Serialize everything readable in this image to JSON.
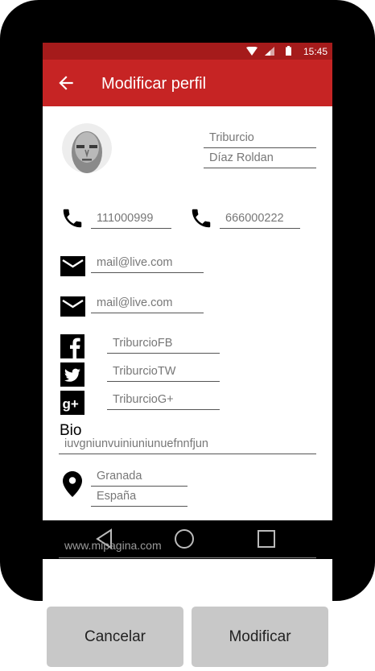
{
  "status_bar": {
    "time": "15:45"
  },
  "app_bar": {
    "title": "Modificar perfil"
  },
  "profile": {
    "first_name": "Triburcio",
    "last_name": "Díaz Roldan"
  },
  "phones": [
    "111000999",
    "666000222"
  ],
  "emails": [
    "mail@live.com",
    "mail@live.com"
  ],
  "social": {
    "facebook": "TriburcioFB",
    "twitter": "TriburcioTW",
    "googleplus": "TriburcioG+"
  },
  "bio": {
    "label": "Bio",
    "value": "iuvgniunvuiniuniunuefnnfjun"
  },
  "location": {
    "city": "Granada",
    "country": "España"
  },
  "website": {
    "value": "www.mipagina.com"
  },
  "actions": {
    "cancel": "Cancelar",
    "modify": "Modificar"
  },
  "colors": {
    "status_bar": "#a51b1b",
    "app_bar": "#c62424",
    "button": "#c8c8c8"
  }
}
